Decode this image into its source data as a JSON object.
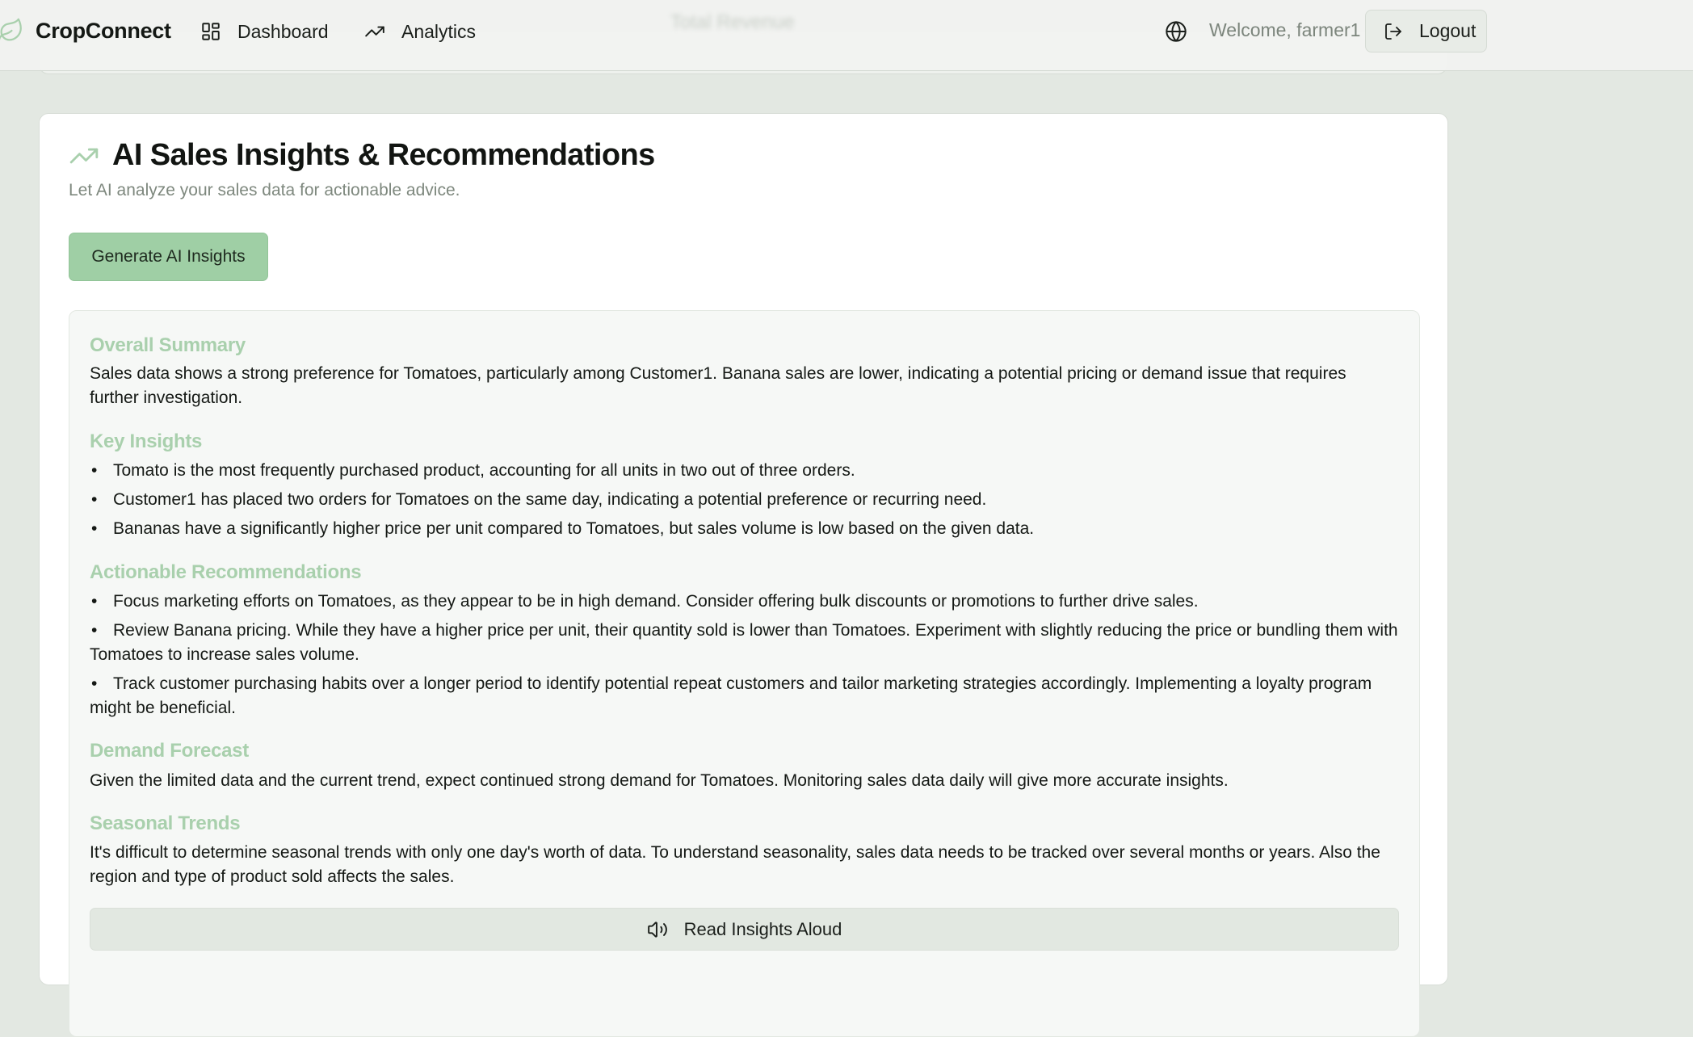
{
  "nav": {
    "brand": "CropConnect",
    "dashboard_label": "Dashboard",
    "analytics_label": "Analytics",
    "welcome_text": "Welcome, farmer1",
    "logout_label": "Logout",
    "ghost_text": "Total Revenue",
    "brand_icon": "leaf-icon",
    "dashboard_icon": "grid-icon",
    "analytics_icon": "trending-up-icon",
    "language_icon": "globe-icon",
    "logout_icon": "logout-icon"
  },
  "card": {
    "title": "AI Sales Insights & Recommendations",
    "subtitle": "Let AI analyze your sales data for actionable advice.",
    "generate_label": "Generate AI Insights",
    "title_icon": "trending-up-icon"
  },
  "insights": {
    "summary_title": "Overall Summary",
    "summary_text": "Sales data shows a strong preference for Tomatoes, particularly among Customer1. Banana sales are lower, indicating a potential pricing or demand issue that requires further investigation.",
    "key_title": "Key Insights",
    "key_items": [
      "Tomato is the most frequently purchased product, accounting for all units in two out of three orders.",
      "Customer1 has placed two orders for Tomatoes on the same day, indicating a potential preference or recurring need.",
      "Bananas have a significantly higher price per unit compared to Tomatoes, but sales volume is low based on the given data."
    ],
    "actions_title": "Actionable Recommendations",
    "action_items": [
      "Focus marketing efforts on Tomatoes, as they appear to be in high demand. Consider offering bulk discounts or promotions to further drive sales.",
      "Review Banana pricing. While they have a higher price per unit, their quantity sold is lower than Tomatoes. Experiment with slightly reducing the price or bundling them with Tomatoes to increase sales volume.",
      "Track customer purchasing habits over a longer period to identify potential repeat customers and tailor marketing strategies accordingly. Implementing a loyalty program might be beneficial."
    ],
    "forecast_title": "Demand Forecast",
    "forecast_text": "Given the limited data and the current trend, expect continued strong demand for Tomatoes. Monitoring sales data daily will give more accurate insights.",
    "seasonal_title": "Seasonal Trends",
    "seasonal_text": "It's difficult to determine seasonal trends with only one day's worth of data. To understand seasonality, sales data needs to be tracked over several months or years. Also the region and type of product sold affects the sales.",
    "read_aloud_label": "Read Insights Aloud",
    "read_aloud_icon": "speaker-icon"
  },
  "colors": {
    "accent": "#9fcfa5",
    "section_heading": "#a9d0ad",
    "background": "#e3e8e2"
  }
}
